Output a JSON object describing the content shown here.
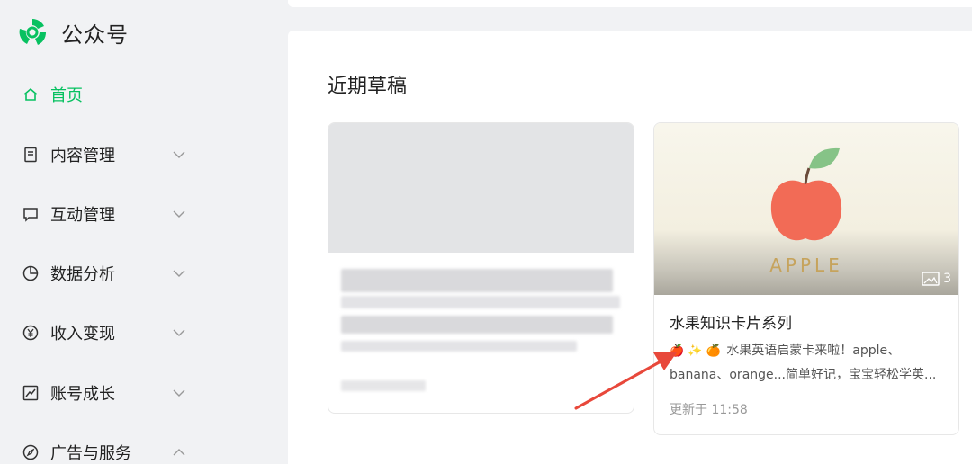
{
  "brand": {
    "name": "公众号"
  },
  "nav": [
    {
      "label": "首页",
      "icon": "home-icon",
      "active": true
    },
    {
      "label": "内容管理",
      "icon": "document-icon"
    },
    {
      "label": "互动管理",
      "icon": "message-icon"
    },
    {
      "label": "数据分析",
      "icon": "pie-chart-icon"
    },
    {
      "label": "收入变现",
      "icon": "yen-icon"
    },
    {
      "label": "账号成长",
      "icon": "trend-icon"
    },
    {
      "label": "广告与服务",
      "icon": "compass-icon"
    }
  ],
  "main": {
    "section_title": "近期草稿",
    "drafts": [
      {
        "redacted": true
      },
      {
        "cover_word": "APPLE",
        "image_count": "3",
        "title": "水果知识卡片系列",
        "emojis": "🍎 ✨ 🍊",
        "desc_text": "水果英语启蒙卡来啦！apple、banana、orange...简单好记，宝宝轻松学英...",
        "updated": "更新于 11:58"
      }
    ]
  },
  "colors": {
    "accent": "#07c160",
    "arrow": "#e8483b",
    "apple": "#f26b56",
    "leaf": "#7fbf7f"
  }
}
